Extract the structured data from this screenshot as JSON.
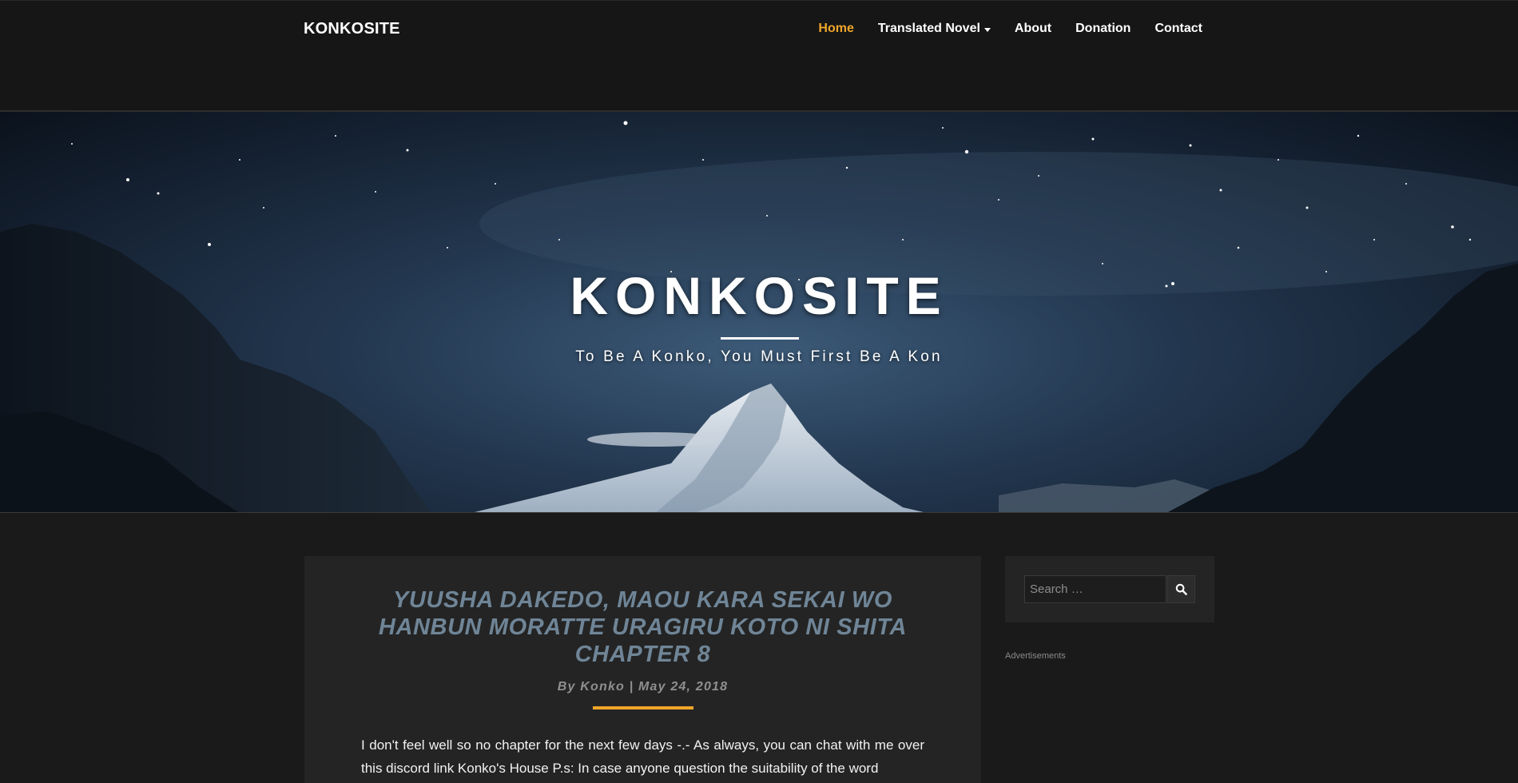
{
  "site": {
    "brand": "KONKOSITE"
  },
  "nav": {
    "items": [
      {
        "label": "Home",
        "active": true
      },
      {
        "label": "Translated Novel",
        "has_dropdown": true
      },
      {
        "label": "About"
      },
      {
        "label": "Donation"
      },
      {
        "label": "Contact"
      }
    ]
  },
  "hero": {
    "title": "KONKOSITE",
    "tagline": "To Be A Konko, You Must First Be A Kon"
  },
  "post": {
    "title": "YUUSHA DAKEDO, MAOU KARA SEKAI WO HANBUN MORATTE URAGIRU KOTO NI SHITA CHAPTER 8",
    "meta": "By Konko | May 24, 2018",
    "excerpt": "I don't feel well so no chapter for the next few days -.- As always, you can chat with me over this discord link  Konko's House P.s: In case anyone question the suitability of the word"
  },
  "sidebar": {
    "search_placeholder": "Search …",
    "ads_label": "Advertisements"
  },
  "icons": {
    "search": "search-icon",
    "dropdown": "caret-down-icon"
  },
  "colors": {
    "accent": "#f0a62a",
    "post_title": "#6f8597",
    "background": "#1a1a1a",
    "card": "#242424"
  }
}
